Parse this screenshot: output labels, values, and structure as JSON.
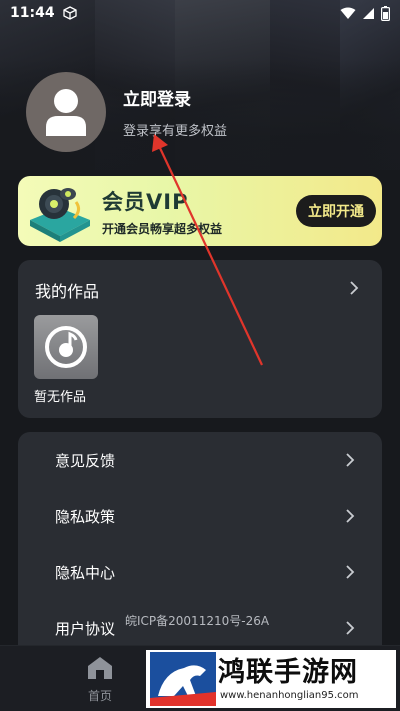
{
  "status_bar": {
    "time": "11:44"
  },
  "profile": {
    "title": "立即登录",
    "subtitle": "登录享有更多权益"
  },
  "vip": {
    "title": "会员VIP",
    "subtitle": "开通会员畅享超多权益",
    "button": "立即开通"
  },
  "works": {
    "header": "我的作品",
    "empty_label": "暂无作品"
  },
  "settings": {
    "items": [
      {
        "label": "意见反馈"
      },
      {
        "label": "隐私政策"
      },
      {
        "label": "隐私中心"
      },
      {
        "label": "用户协议"
      }
    ]
  },
  "icp_text": "皖ICP备20011210号-26A",
  "tabbar": {
    "home_label": "首页"
  },
  "watermark": {
    "title": "鸿联手游网",
    "url": "www.henanhonglian95.com"
  },
  "colors": {
    "background": "#17191d",
    "card": "#2a2d33",
    "vip_gradient_start": "#f4fbb8",
    "vip_gradient_end": "#f3e98a",
    "vip_button": "#1c1c1c",
    "arrow": "#e0352b"
  },
  "icons": {
    "status": [
      "box-icon",
      "wifi-icon",
      "signal-icon",
      "battery-icon"
    ],
    "avatar": "user-silhouette-icon",
    "chevron": "chevron-right-icon",
    "empty_works": "music-disc-icon",
    "home": "home-icon"
  }
}
